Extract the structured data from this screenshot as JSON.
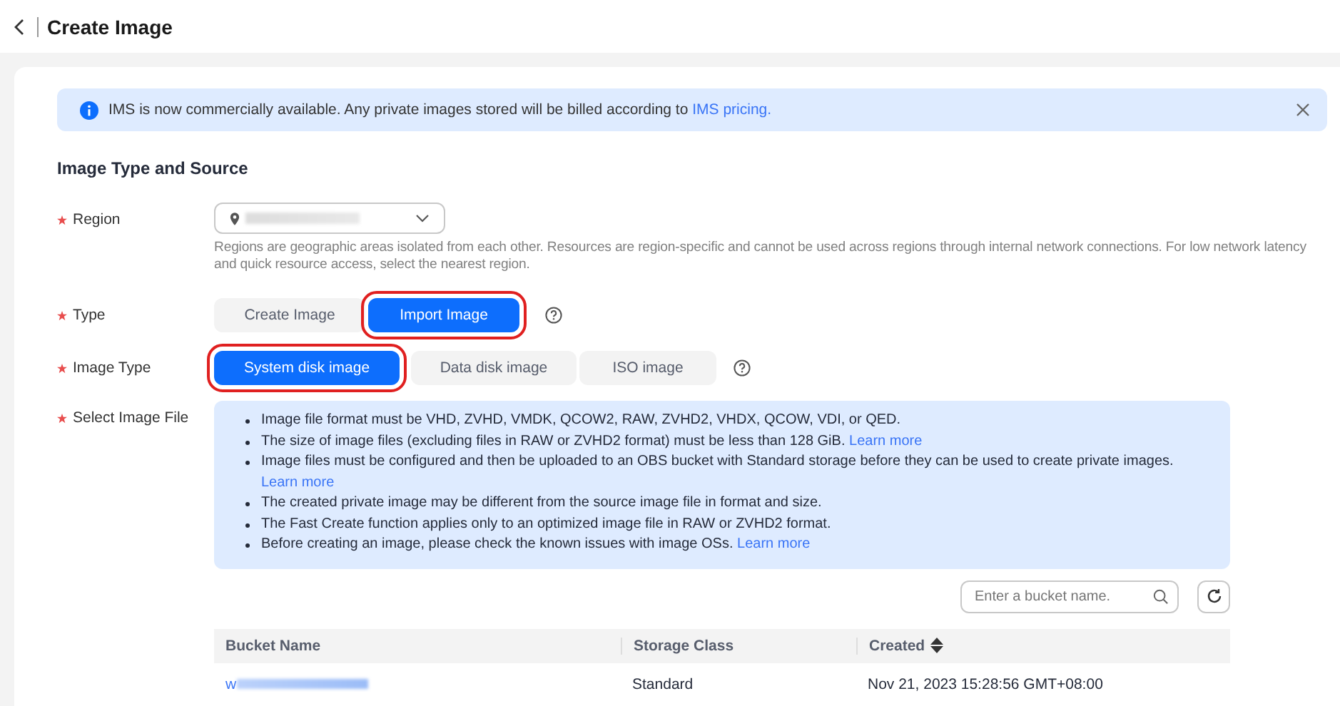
{
  "page": {
    "title": "Create Image"
  },
  "notice": {
    "text": "IMS is now commercially available. Any private images stored will be billed according to ",
    "link": "IMS pricing."
  },
  "section_title": "Image Type and Source",
  "region": {
    "label": "Region",
    "required": true,
    "description": "Regions are geographic areas isolated from each other. Resources are region-specific and cannot be used across regions through internal network connections. For low network latency and quick resource access, select the nearest region."
  },
  "type": {
    "label": "Type",
    "required": true,
    "options": [
      {
        "label": "Create Image",
        "selected": false,
        "highlighted": false
      },
      {
        "label": "Import Image",
        "selected": true,
        "highlighted": true
      }
    ]
  },
  "image_type": {
    "label": "Image Type",
    "required": true,
    "options": [
      {
        "label": "System disk image",
        "selected": true,
        "highlighted": true
      },
      {
        "label": "Data disk image",
        "selected": false,
        "highlighted": false
      },
      {
        "label": "ISO image",
        "selected": false,
        "highlighted": false
      }
    ]
  },
  "select_file": {
    "label": "Select Image File",
    "required": true,
    "notes": [
      {
        "text": "Image file format must be VHD, ZVHD, VMDK, QCOW2, RAW, ZVHD2, VHDX, QCOW, VDI, or QED."
      },
      {
        "text": "The size of image files (excluding files in RAW or ZVHD2 format) must be less than 128 GiB. ",
        "link": "Learn more"
      },
      {
        "text": "Image files must be configured and then be uploaded to an OBS bucket with Standard storage before they can be used to create private images. ",
        "link": "Learn more"
      },
      {
        "text": "The created private image may be different from the source image file in format and size."
      },
      {
        "text": "The Fast Create function applies only to an optimized image file in RAW or ZVHD2 format."
      },
      {
        "text": "Before creating an image, please check the known issues with image OSs. ",
        "link": "Learn more"
      }
    ]
  },
  "bucket_search": {
    "placeholder": "Enter a bucket name."
  },
  "table": {
    "columns": [
      {
        "label": "Bucket Name"
      },
      {
        "label": "Storage Class"
      },
      {
        "label": "Created",
        "sortable": true
      }
    ],
    "rows": [
      {
        "cells": [
          "w",
          "Standard",
          "Nov 21, 2023 15:28:56 GMT+08:00"
        ]
      }
    ]
  }
}
